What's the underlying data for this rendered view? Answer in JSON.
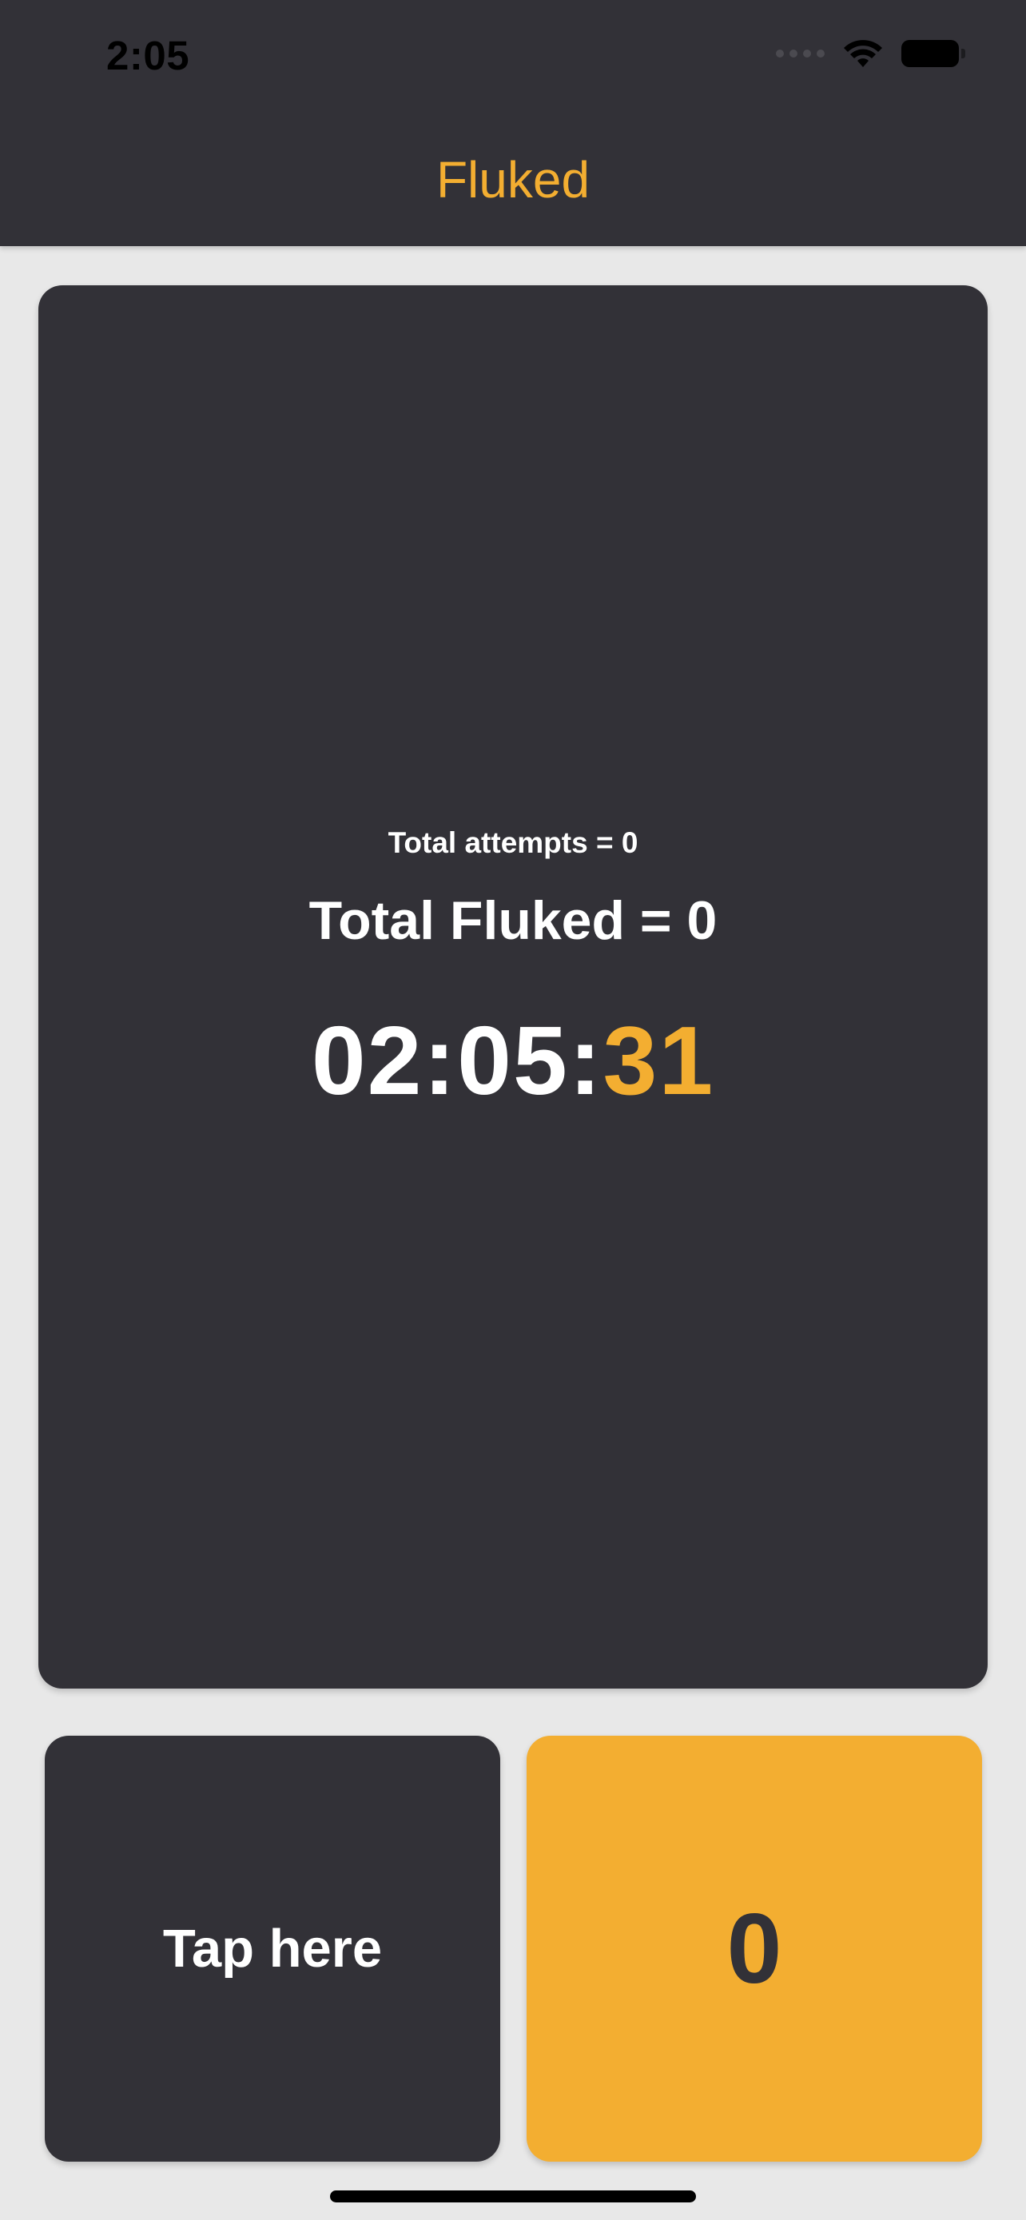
{
  "status_bar": {
    "time": "2:05",
    "signal_icon": "cellular-signal-icon",
    "wifi_icon": "wifi-icon",
    "battery_icon": "battery-icon"
  },
  "header": {
    "title": "Fluked"
  },
  "stats": {
    "attempts_text": "Total attempts = 0",
    "fluked_text": "Total Fluked = 0"
  },
  "timer": {
    "main": "02:05:",
    "accent": "31"
  },
  "actions": {
    "tap_label": "Tap here",
    "count_value": "0"
  },
  "colors": {
    "accent": "#f3ae31",
    "dark": "#323137",
    "background": "#e8e8e8"
  }
}
